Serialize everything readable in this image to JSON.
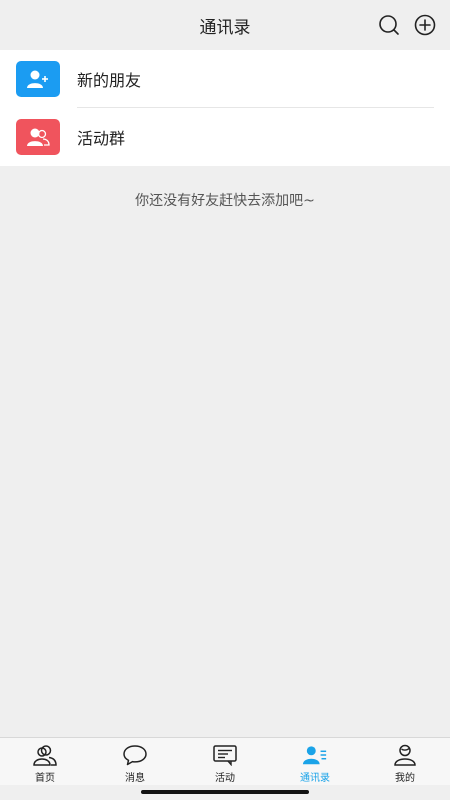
{
  "header": {
    "title": "通讯录"
  },
  "menu": [
    {
      "label": "新的朋友",
      "icon": "add-user-icon",
      "color": "#1b9cf2"
    },
    {
      "label": "活动群",
      "icon": "group-icon",
      "color": "#f0545d"
    }
  ],
  "empty_tip": "你还没有好友赶快去添加吧~",
  "tabs": [
    {
      "label": "首页",
      "icon": "home-people-icon",
      "active": false
    },
    {
      "label": "消息",
      "icon": "chat-bubble-icon",
      "active": false
    },
    {
      "label": "活动",
      "icon": "activity-board-icon",
      "active": false
    },
    {
      "label": "通讯录",
      "icon": "contacts-icon",
      "active": true
    },
    {
      "label": "我的",
      "icon": "profile-icon",
      "active": false
    }
  ],
  "colors": {
    "accent": "#1aa3e8",
    "background": "#efefef"
  }
}
